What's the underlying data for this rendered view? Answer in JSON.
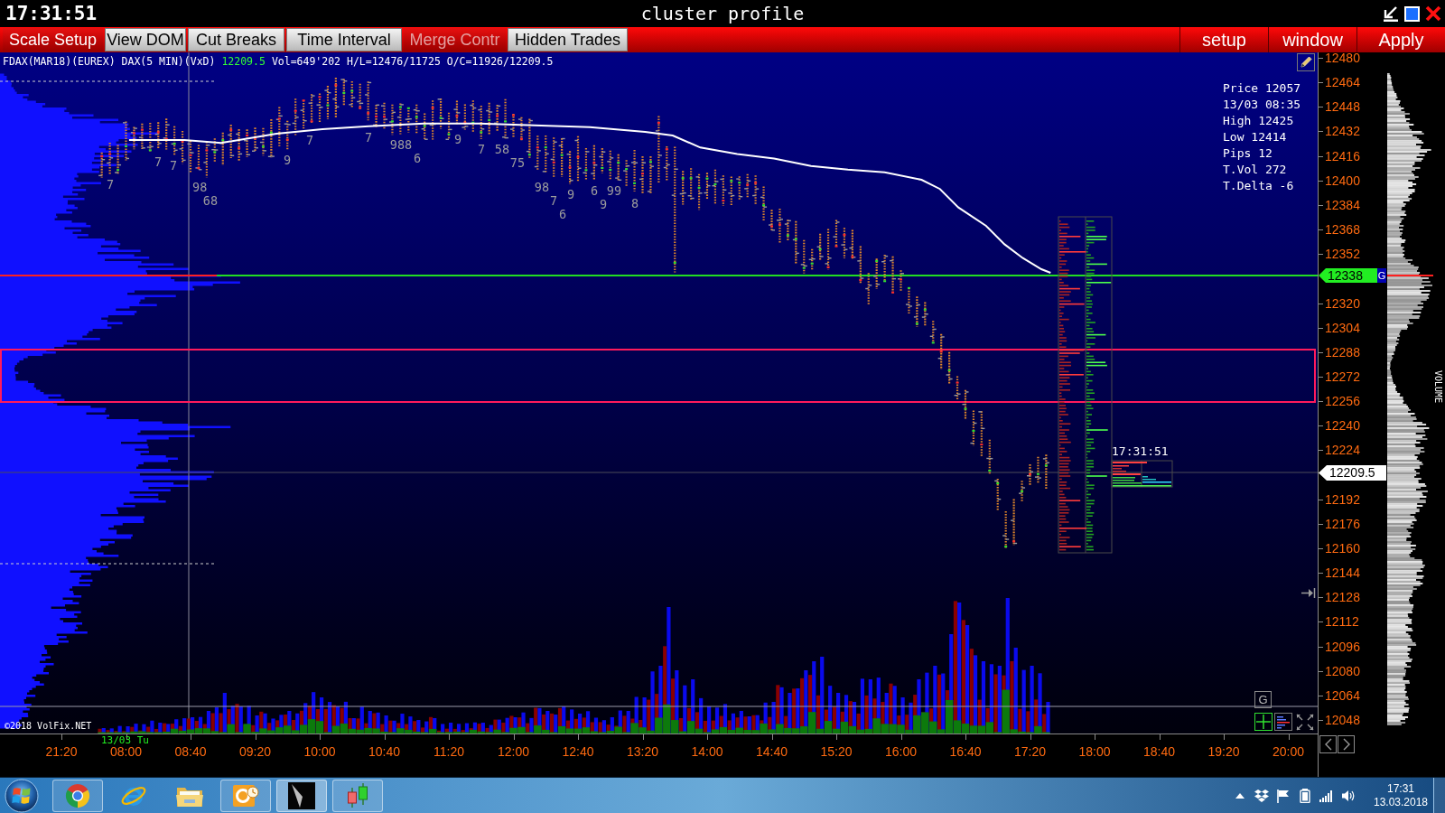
{
  "title_bar": {
    "clock": "17:31:51",
    "title": "cluster profile"
  },
  "toolbar": {
    "buttons": [
      {
        "label": "Scale Setup",
        "on": false,
        "disabled": false
      },
      {
        "label": "View DOM",
        "on": true,
        "disabled": false
      },
      {
        "label": "Cut Breaks",
        "on": true,
        "disabled": false
      },
      {
        "label": "Time Interval",
        "on": true,
        "disabled": false
      },
      {
        "label": "Merge Contr",
        "on": false,
        "disabled": true
      },
      {
        "label": "Hidden Trades",
        "on": true,
        "disabled": false
      }
    ],
    "menu": [
      "setup",
      "window",
      "Apply"
    ]
  },
  "chart": {
    "instrument": "FDAX(MAR18)(EUREX) DAX(5 MIN)(VxD)",
    "last_price": "12209.5",
    "stats": "Vol=649'202 H/L=12476/11725 O/C=11926/12209.5",
    "info_box": [
      "Price 12057",
      "13/03 08:35",
      "High 12425",
      "Low 12414",
      "Pips 12",
      "T.Vol 272",
      "T.Delta -6"
    ],
    "cluster_labels": [
      "7",
      "7",
      "7",
      "98",
      "68",
      "9",
      "7",
      "7",
      "988",
      "6",
      "9",
      "7",
      "58",
      "75",
      "98",
      "7",
      "6",
      "9",
      "6",
      "9",
      "99",
      "8"
    ],
    "clock_label": "17:31:51",
    "copyright": "©2018 VolFix.NET",
    "g_button": "G"
  },
  "price_axis": {
    "labels": [
      "12480",
      "12464",
      "12448",
      "12432",
      "12416",
      "12400",
      "12384",
      "12368",
      "12352",
      "12320",
      "12304",
      "12288",
      "12272",
      "12256",
      "12240",
      "12224",
      "12192",
      "12176",
      "12160",
      "12144",
      "12128",
      "12112",
      "12096",
      "12080",
      "12064",
      "12048"
    ],
    "level_tag": {
      "price": "12338",
      "flag": "G"
    },
    "last_price_tag": "12209.5"
  },
  "time_axis": {
    "date_label": "13/03 Tu",
    "labels": [
      "21:20",
      "08:00",
      "08:40",
      "09:20",
      "10:00",
      "10:40",
      "11:20",
      "12:00",
      "12:40",
      "13:20",
      "14:00",
      "14:40",
      "15:20",
      "16:00",
      "16:40",
      "17:20",
      "18:00",
      "18:40",
      "19:20",
      "20:00"
    ]
  },
  "volume_panel": {
    "title": "VOLUME"
  },
  "taskbar": {
    "apps": [
      {
        "kind": "circle",
        "running": true,
        "selected": false
      },
      {
        "kind": "orbit",
        "running": false,
        "selected": false
      },
      {
        "kind": "folder",
        "running": false,
        "selected": false
      },
      {
        "kind": "mail",
        "running": true,
        "selected": false
      },
      {
        "kind": "dark",
        "running": true,
        "selected": true
      },
      {
        "kind": "candles",
        "running": true,
        "selected": false
      }
    ],
    "clock": "17:31",
    "date": "13.03.2018"
  }
}
